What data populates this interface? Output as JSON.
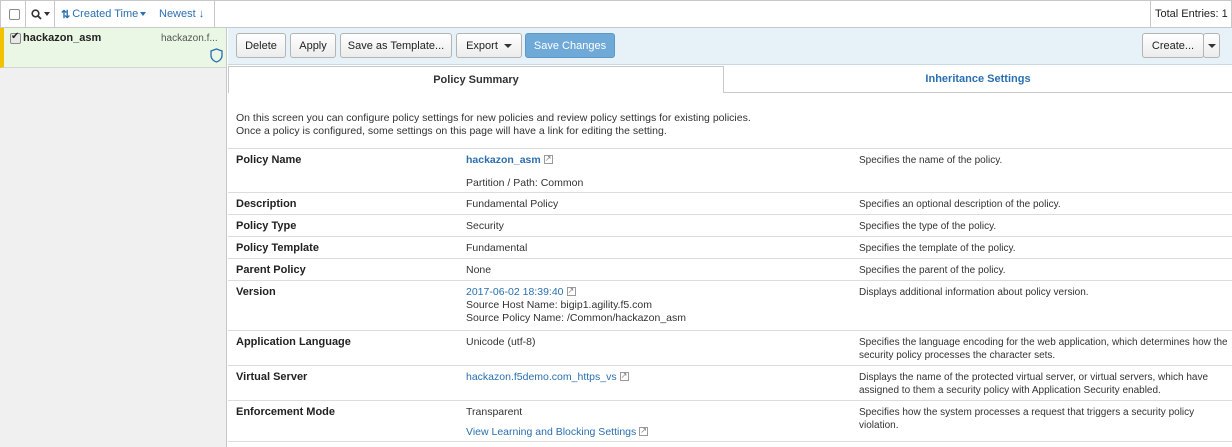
{
  "filterbar": {
    "sort_label": "Created Time",
    "order_label": "Newest",
    "total_entries": "Total Entries: 1"
  },
  "list": {
    "items": [
      {
        "name": "hackazon_asm",
        "sub": "hackazon.f..."
      }
    ]
  },
  "toolbar": {
    "delete": "Delete",
    "apply": "Apply",
    "save_template": "Save as Template...",
    "export": "Export",
    "save_changes": "Save Changes",
    "create": "Create..."
  },
  "tabs": {
    "summary": "Policy Summary",
    "inheritance": "Inheritance Settings"
  },
  "intro": {
    "line1": "On this screen you can configure policy settings for new policies and review policy settings for existing policies.",
    "line2": "Once a policy is configured, some settings on this page will have a link for editing the setting."
  },
  "rows": {
    "policy_name": {
      "label": "Policy Name",
      "value": "hackazon_asm",
      "value2": "Partition / Path: Common",
      "desc": "Specifies the name of the policy."
    },
    "description": {
      "label": "Description",
      "value": "Fundamental Policy",
      "desc": "Specifies an optional description of the policy."
    },
    "policy_type": {
      "label": "Policy Type",
      "value": "Security",
      "desc": "Specifies the type of the policy."
    },
    "policy_template": {
      "label": "Policy Template",
      "value": "Fundamental",
      "desc": "Specifies the template of the policy."
    },
    "parent_policy": {
      "label": "Parent Policy",
      "value": "None",
      "desc": "Specifies the parent of the policy."
    },
    "version": {
      "label": "Version",
      "value": "2017-06-02 18:39:40",
      "value2": "Source Host Name: bigip1.agility.f5.com",
      "value3": "Source Policy Name: /Common/hackazon_asm",
      "desc": "Displays additional information about policy version."
    },
    "app_language": {
      "label": "Application Language",
      "value": "Unicode (utf-8)",
      "desc1": "Specifies the language encoding for the web application, which determines",
      "desc2": "how the security policy processes the character sets."
    },
    "virtual_server": {
      "label": "Virtual Server",
      "value": "hackazon.f5demo.com_https_vs",
      "desc1": "Displays the name of the protected virtual server, or virtual servers, which",
      "desc2": "have assigned to them a security policy with Application Security enabled."
    },
    "enforcement_mode": {
      "label": "Enforcement Mode",
      "value": "Transparent",
      "value2": "View Learning and Blocking Settings",
      "desc1": "Specifies how the system processes a request that triggers a security policy",
      "desc2": "violation."
    }
  }
}
